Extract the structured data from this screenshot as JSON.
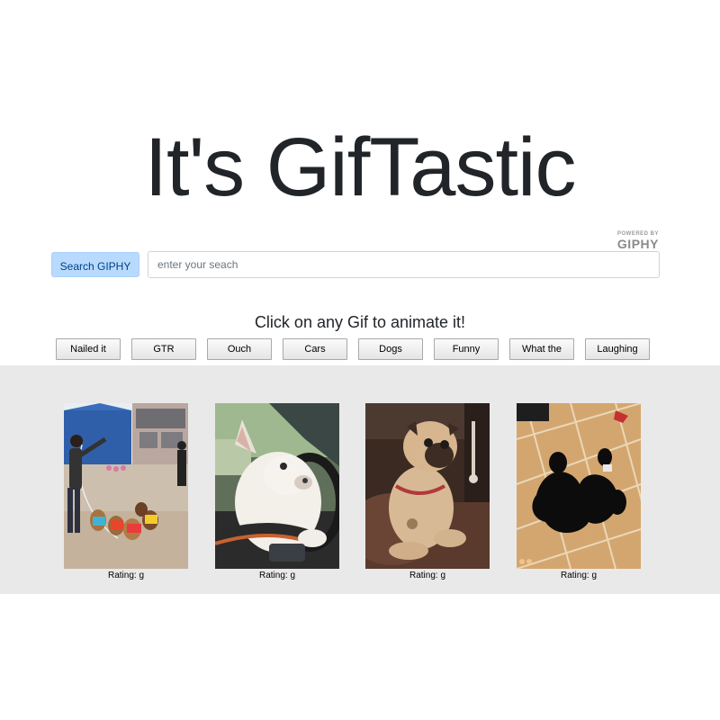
{
  "header": {
    "title": "It's GifTastic",
    "powered_by_small": "POWERED BY",
    "powered_by_brand": "GIPHY"
  },
  "search": {
    "button_label": "Search GIPHY",
    "placeholder": "enter your seach",
    "value": ""
  },
  "instruction": "Click on any Gif to animate it!",
  "topics": [
    "Nailed it",
    "GTR",
    "Ouch",
    "Cars",
    "Dogs",
    "Funny",
    "What the",
    "Laughing"
  ],
  "gifs": [
    {
      "rating": "Rating: g",
      "subject": "dogs-in-costumes-jumping-rope"
    },
    {
      "rating": "Rating: g",
      "subject": "french-bulldog-driving"
    },
    {
      "rating": "Rating: g",
      "subject": "pug-on-couch"
    },
    {
      "rating": "Rating: g",
      "subject": "black-dogs-on-tile-floor"
    }
  ],
  "colors": {
    "search_button_bg": "#b8daff",
    "search_button_text": "#004085",
    "gif_area_bg": "#e9e9e9"
  }
}
